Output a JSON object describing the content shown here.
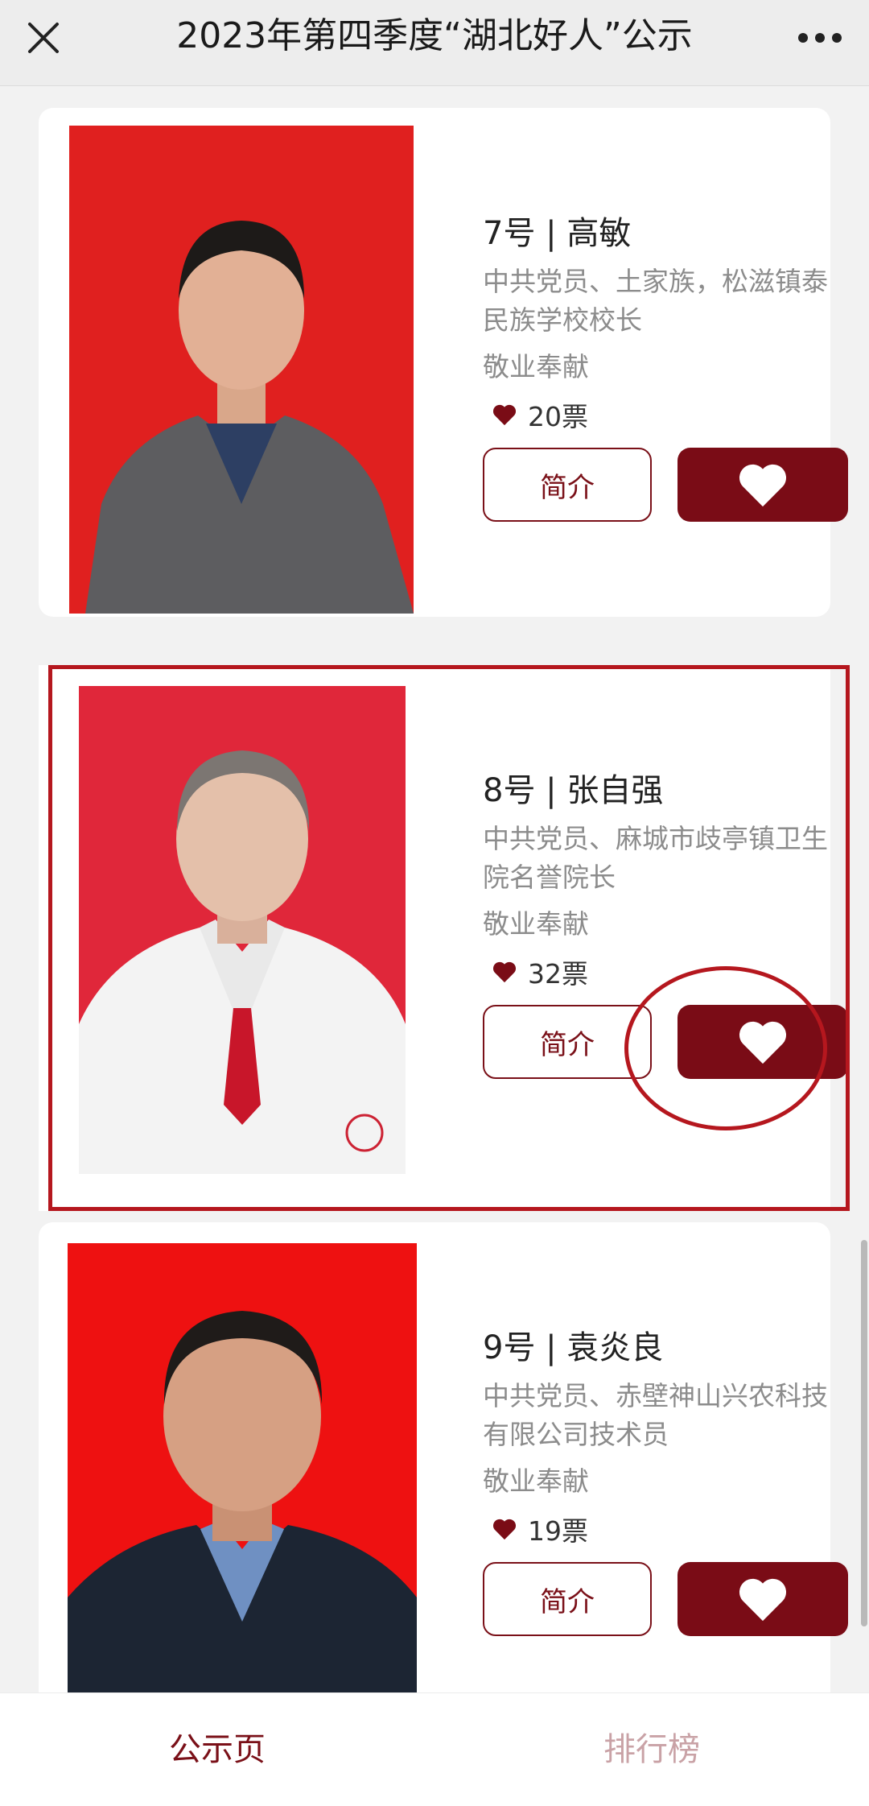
{
  "header": {
    "title": "2023年第四季度“湖北好人”公示"
  },
  "candidates": [
    {
      "number_name": "7号 | 高敏",
      "description": "中共党员、土家族，松滋镇泰民族学校校长",
      "category": "敬业奉献",
      "votes": "20票",
      "intro_label": "简介"
    },
    {
      "number_name": "8号 | 张自强",
      "description": "中共党员、麻城市歧亭镇卫生院名誉院长",
      "category": "敬业奉献",
      "votes": "32票",
      "intro_label": "简介"
    },
    {
      "number_name": "9号 | 袁炎良",
      "description": "中共党员、赤壁神山兴农科技有限公司技术员",
      "category": "敬业奉献",
      "votes": "19票",
      "intro_label": "简介"
    }
  ],
  "tabs": [
    {
      "label": "公示页",
      "active": true
    },
    {
      "label": "排行榜",
      "active": false
    }
  ],
  "colors": {
    "accent": "#7a0c16",
    "photo_red": "#e0201f",
    "highlight": "#b5171e"
  }
}
